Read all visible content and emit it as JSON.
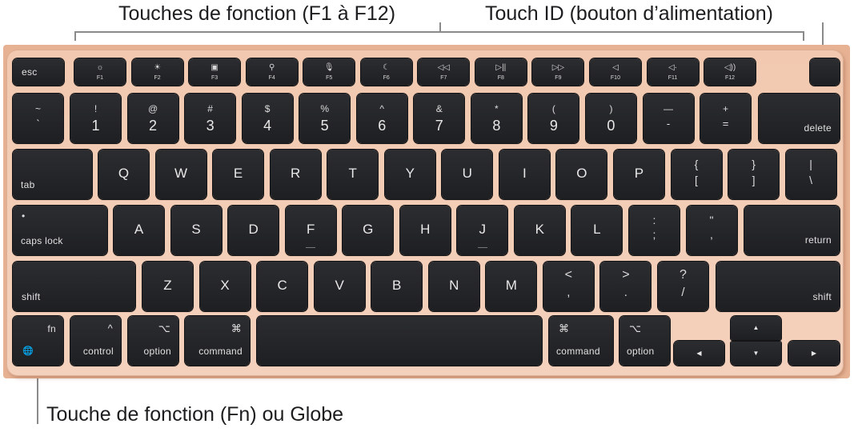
{
  "callouts": {
    "function_keys": "Touches de fonction (F1 à F12)",
    "touch_id": "Touch ID (bouton d’alimentation)",
    "fn_globe": "Touche de fonction (Fn) ou Globe"
  },
  "keyboard": {
    "colors": {
      "body": "#e7b294",
      "key": "#222326",
      "legend": "#e6e6e6",
      "callout_line": "#8a8a8a"
    },
    "row_function": {
      "esc": "esc",
      "fkeys": [
        {
          "label": "F1",
          "icon": "brightness-down-icon",
          "glyph": "☼"
        },
        {
          "label": "F2",
          "icon": "brightness-up-icon",
          "glyph": "☀"
        },
        {
          "label": "F3",
          "icon": "mission-control-icon",
          "glyph": "▣"
        },
        {
          "label": "F4",
          "icon": "spotlight-search-icon",
          "glyph": "⚲"
        },
        {
          "label": "F5",
          "icon": "dictation-mic-icon",
          "glyph": "🎙"
        },
        {
          "label": "F6",
          "icon": "do-not-disturb-moon-icon",
          "glyph": "☾"
        },
        {
          "label": "F7",
          "icon": "rewind-icon",
          "glyph": "◁◁"
        },
        {
          "label": "F8",
          "icon": "play-pause-icon",
          "glyph": "▷||"
        },
        {
          "label": "F9",
          "icon": "fast-forward-icon",
          "glyph": "▷▷"
        },
        {
          "label": "F10",
          "icon": "mute-icon",
          "glyph": "◁"
        },
        {
          "label": "F11",
          "icon": "volume-down-icon",
          "glyph": "◁·"
        },
        {
          "label": "F12",
          "icon": "volume-up-icon",
          "glyph": "◁))"
        }
      ],
      "touch_id": ""
    },
    "row_numbers": {
      "keys": [
        {
          "top": "~",
          "bottom": "`"
        },
        {
          "top": "!",
          "bottom": "1"
        },
        {
          "top": "@",
          "bottom": "2"
        },
        {
          "top": "#",
          "bottom": "3"
        },
        {
          "top": "$",
          "bottom": "4"
        },
        {
          "top": "%",
          "bottom": "5"
        },
        {
          "top": "^",
          "bottom": "6"
        },
        {
          "top": "&",
          "bottom": "7"
        },
        {
          "top": "*",
          "bottom": "8"
        },
        {
          "top": "(",
          "bottom": "9"
        },
        {
          "top": ")",
          "bottom": "0"
        },
        {
          "top": "—",
          "bottom": "-"
        },
        {
          "top": "+",
          "bottom": "="
        }
      ],
      "delete": "delete"
    },
    "row_qwerty": {
      "tab": "tab",
      "letters": [
        "Q",
        "W",
        "E",
        "R",
        "T",
        "Y",
        "U",
        "I",
        "O",
        "P"
      ],
      "brackets": [
        {
          "top": "{",
          "bottom": "["
        },
        {
          "top": "}",
          "bottom": "]"
        },
        {
          "top": "|",
          "bottom": "\\"
        }
      ]
    },
    "row_home": {
      "caps_lock": "caps lock",
      "caps_indicator": "•",
      "letters": [
        "A",
        "S",
        "D",
        "F",
        "G",
        "H",
        "J",
        "K",
        "L"
      ],
      "punct": [
        {
          "top": ":",
          "bottom": ";"
        },
        {
          "top": "\"",
          "bottom": ","
        }
      ],
      "return": "return"
    },
    "row_shift": {
      "shift_left": "shift",
      "letters": [
        "Z",
        "X",
        "C",
        "V",
        "B",
        "N",
        "M"
      ],
      "punct": [
        {
          "top": "<",
          "bottom": ","
        },
        {
          "top": ">",
          "bottom": "."
        },
        {
          "top": "?",
          "bottom": "/"
        }
      ],
      "shift_right": "shift"
    },
    "row_bottom": {
      "fn": {
        "label": "fn",
        "icon": "globe-icon",
        "glyph": "🌐"
      },
      "control": {
        "label": "control",
        "symbol": "^"
      },
      "option_left": {
        "label": "option",
        "symbol": "⌥"
      },
      "command_left": {
        "label": "command",
        "symbol": "⌘"
      },
      "space": "",
      "command_right": {
        "label": "command",
        "symbol": "⌘"
      },
      "option_right": {
        "label": "option",
        "symbol": "⌥"
      },
      "arrows": {
        "left": "◀",
        "up": "▲",
        "down": "▼",
        "right": "▶"
      }
    }
  }
}
